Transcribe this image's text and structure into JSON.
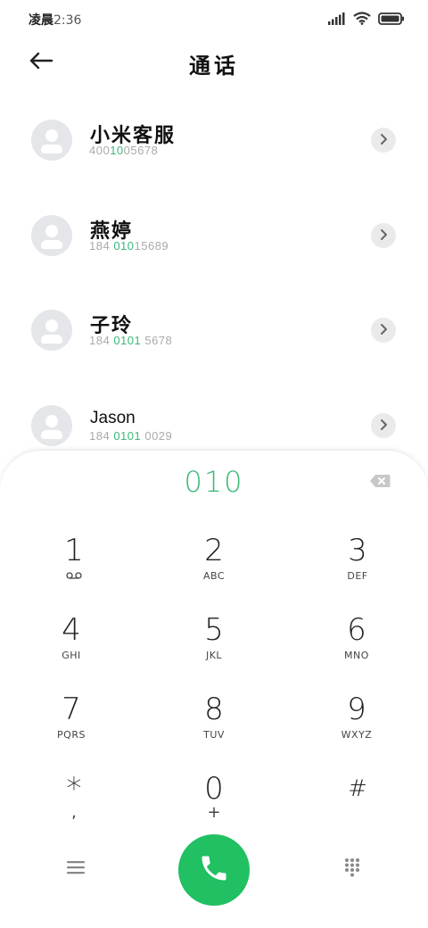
{
  "status_bar": {
    "time_label": "凌晨",
    "time_value": "2:36",
    "icons": [
      "signal-icon",
      "wifi-icon",
      "battery-icon"
    ]
  },
  "header": {
    "title": "通话",
    "back_icon": "back-arrow-icon"
  },
  "contacts": [
    {
      "name": "小米客服",
      "number_parts": [
        "400",
        "10",
        "05678"
      ],
      "highlight_index": 1
    },
    {
      "name": "燕婷",
      "number_parts": [
        "184 ",
        "010",
        "15689"
      ],
      "highlight_index": 1
    },
    {
      "name": "子玲",
      "number_parts": [
        "184 ",
        "0101",
        " 5678"
      ],
      "highlight_index": 1
    },
    {
      "name": "Jason",
      "number_parts": [
        "184 ",
        "0101",
        " 0029"
      ],
      "highlight_index": 1
    }
  ],
  "dialer": {
    "input_value": "010",
    "keys": [
      {
        "digit": "1",
        "letters": "",
        "icon": "voicemail-icon"
      },
      {
        "digit": "2",
        "letters": "ABC"
      },
      {
        "digit": "3",
        "letters": "DEF"
      },
      {
        "digit": "4",
        "letters": "GHI"
      },
      {
        "digit": "5",
        "letters": "JKL"
      },
      {
        "digit": "6",
        "letters": "MNO"
      },
      {
        "digit": "7",
        "letters": "PQRS"
      },
      {
        "digit": "8",
        "letters": "TUV"
      },
      {
        "digit": "9",
        "letters": "WXYZ"
      },
      {
        "digit": "*",
        "letters": ","
      },
      {
        "digit": "0",
        "letters": "+"
      },
      {
        "digit": "#",
        "letters": ""
      }
    ]
  },
  "colors": {
    "accent": "#3cb878",
    "call_button": "#21c063",
    "avatar_bg": "#e4e6ea"
  }
}
